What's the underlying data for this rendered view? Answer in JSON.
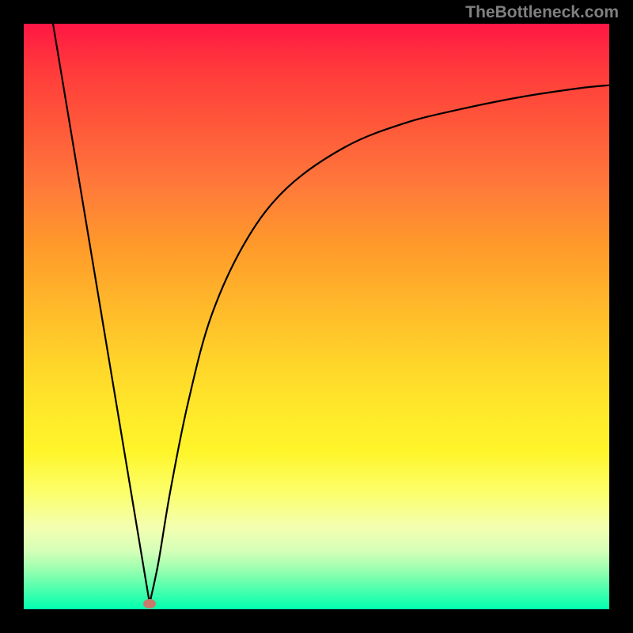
{
  "watermark": "TheBottleneck.com",
  "chart_data": {
    "type": "line",
    "title": "",
    "xlabel": "",
    "ylabel": "",
    "xlim": [
      0,
      100
    ],
    "ylim": [
      0,
      100
    ],
    "background_gradient": {
      "top": "#ff1744",
      "mid": "#ffd52a",
      "bottom": "#00ffae"
    },
    "marker": {
      "x": 21.5,
      "y": 1.0,
      "color": "#c97a6a"
    },
    "series": [
      {
        "name": "bottleneck-curve",
        "segment": "left",
        "x": [
          5.0,
          10.0,
          15.0,
          20.0,
          21.5
        ],
        "y": [
          100.0,
          70.0,
          40.0,
          10.0,
          1.0
        ]
      },
      {
        "name": "bottleneck-curve",
        "segment": "right",
        "x": [
          21.5,
          23.0,
          25.0,
          28.0,
          32.0,
          38.0,
          45.0,
          55.0,
          65.0,
          75.0,
          85.0,
          95.0,
          100.0
        ],
        "y": [
          1.0,
          8.0,
          20.0,
          35.0,
          50.0,
          63.0,
          72.0,
          79.0,
          83.0,
          85.5,
          87.5,
          89.0,
          89.5
        ]
      }
    ]
  }
}
